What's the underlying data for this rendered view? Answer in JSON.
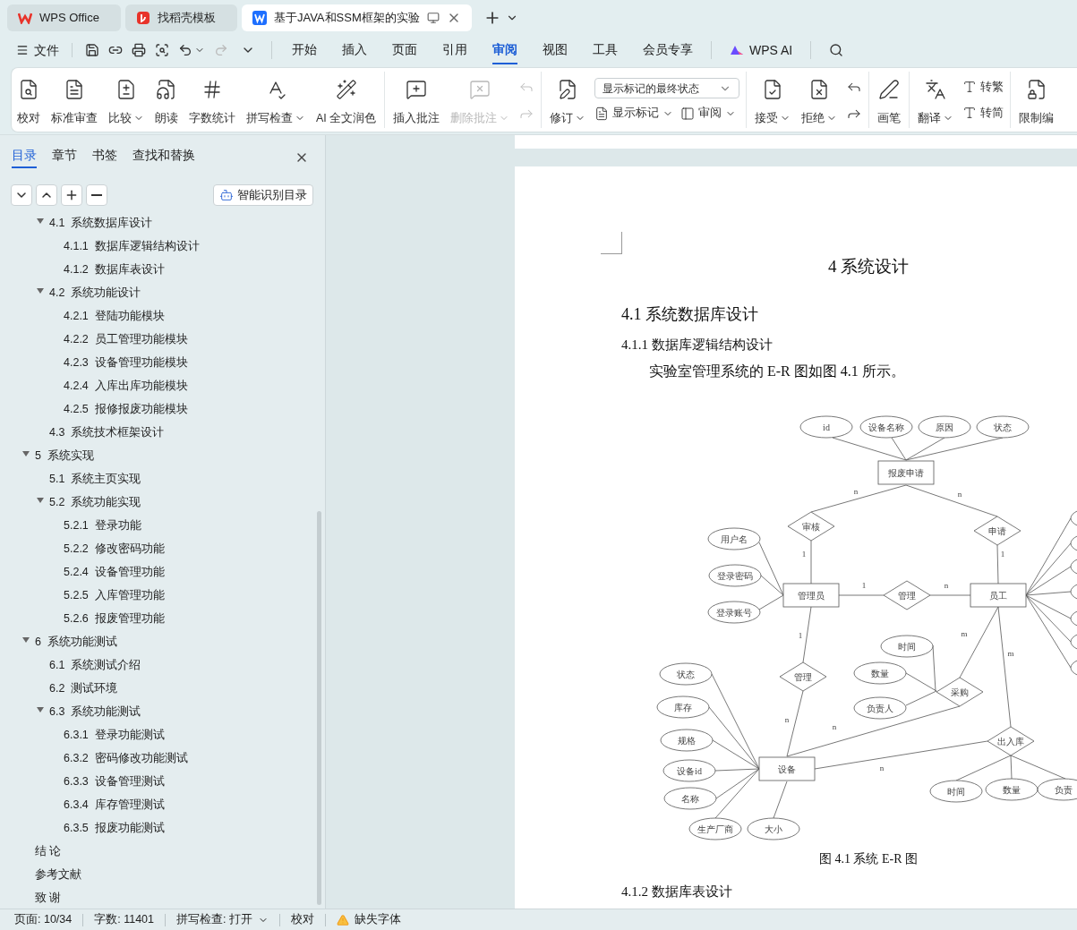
{
  "tabs": [
    {
      "label": "WPS Office",
      "selected": false
    },
    {
      "label": "找稻壳模板",
      "selected": false
    },
    {
      "label": "基于JAVA和SSM框架的实验",
      "selected": true
    }
  ],
  "quick_toolbar": {
    "file_label": "文件",
    "redo_disabled": true
  },
  "menu": [
    {
      "label": "开始",
      "selected": false
    },
    {
      "label": "插入",
      "selected": false
    },
    {
      "label": "页面",
      "selected": false
    },
    {
      "label": "引用",
      "selected": false
    },
    {
      "label": "审阅",
      "selected": true
    },
    {
      "label": "视图",
      "selected": false
    },
    {
      "label": "工具",
      "selected": false
    },
    {
      "label": "会员专享",
      "selected": false
    }
  ],
  "ai_label": "WPS AI",
  "ribbon": [
    {
      "items": [
        {
          "kind": "large",
          "label": "校对",
          "dropdown": false,
          "disabled": false
        },
        {
          "kind": "large",
          "label": "标准审查",
          "dropdown": false,
          "disabled": false
        },
        {
          "kind": "large",
          "label": "比较",
          "dropdown": true,
          "disabled": false
        },
        {
          "kind": "large",
          "label": "朗读",
          "dropdown": false,
          "disabled": false
        },
        {
          "kind": "large",
          "label": "字数统计",
          "dropdown": false,
          "disabled": false
        },
        {
          "kind": "large",
          "label": "拼写检查",
          "dropdown": true,
          "disabled": false
        },
        {
          "kind": "large",
          "label": "AI 全文润色",
          "dropdown": false,
          "disabled": false
        }
      ]
    },
    {
      "items": [
        {
          "kind": "large",
          "label": "插入批注",
          "dropdown": false,
          "disabled": false
        },
        {
          "kind": "large",
          "label": "删除批注",
          "dropdown": true,
          "disabled": true
        },
        {
          "kind": "pair",
          "disabled": true
        }
      ]
    },
    {
      "items": [
        {
          "kind": "large",
          "label": "修订",
          "dropdown": true,
          "disabled": false
        },
        {
          "kind": "markup",
          "select": "显示标记的最终状态",
          "buttons": [
            {
              "label": "显示标记",
              "dropdown": true
            },
            {
              "label": "审阅",
              "dropdown": true
            }
          ]
        }
      ]
    },
    {
      "items": [
        {
          "kind": "large",
          "label": "接受",
          "dropdown": true,
          "disabled": false
        },
        {
          "kind": "large",
          "label": "拒绝",
          "dropdown": true,
          "disabled": false
        },
        {
          "kind": "pair",
          "disabled": false
        }
      ]
    },
    {
      "items": [
        {
          "kind": "large",
          "label": "画笔",
          "dropdown": false,
          "disabled": false
        }
      ]
    },
    {
      "items": [
        {
          "kind": "large",
          "label": "翻译",
          "dropdown": true,
          "disabled": false
        },
        {
          "kind": "stack",
          "buttons": [
            {
              "label": "转繁"
            },
            {
              "label": "转简"
            }
          ]
        }
      ]
    },
    {
      "items": [
        {
          "kind": "large",
          "label": "限制编",
          "dropdown": false,
          "disabled": false
        }
      ]
    }
  ],
  "sidebar": {
    "tabs": [
      {
        "label": "目录",
        "selected": true
      },
      {
        "label": "章节",
        "selected": false
      },
      {
        "label": "书签",
        "selected": false
      },
      {
        "label": "查找和替换",
        "selected": false
      }
    ],
    "smart_toc_button": "智能识别目录",
    "toc_continued": [
      {
        "number": "4.1",
        "title": "系统数据库设计",
        "expanded": true,
        "children": [
          {
            "number": "4.1.1",
            "title": "数据库逻辑结构设计"
          },
          {
            "number": "4.1.2",
            "title": "数据库表设计"
          }
        ]
      },
      {
        "number": "4.2",
        "title": "系统功能设计",
        "expanded": true,
        "children": [
          {
            "number": "4.2.1",
            "title": "登陆功能模块"
          },
          {
            "number": "4.2.2",
            "title": "员工管理功能模块"
          },
          {
            "number": "4.2.3",
            "title": "设备管理功能模块"
          },
          {
            "number": "4.2.4",
            "title": "入库出库功能模块"
          },
          {
            "number": "4.2.5",
            "title": "报修报废功能模块"
          }
        ]
      },
      {
        "number": "4.3",
        "title": "系统技术框架设计"
      }
    ],
    "toc": [
      {
        "number": "5",
        "title": "系统实现",
        "expanded": true,
        "children": [
          {
            "number": "5.1",
            "title": "系统主页实现"
          },
          {
            "number": "5.2",
            "title": "系统功能实现",
            "expanded": true,
            "children": [
              {
                "number": "5.2.1",
                "title": "登录功能"
              },
              {
                "number": "5.2.2",
                "title": "修改密码功能"
              },
              {
                "number": "5.2.4",
                "title": "设备管理功能"
              },
              {
                "number": "5.2.5",
                "title": "入库管理功能"
              },
              {
                "number": "5.2.6",
                "title": "报废管理功能"
              }
            ]
          }
        ]
      },
      {
        "number": "6",
        "title": "系统功能测试",
        "expanded": true,
        "children": [
          {
            "number": "6.1",
            "title": "系统测试介绍"
          },
          {
            "number": "6.2",
            "title": "测试环境"
          },
          {
            "number": "6.3",
            "title": "系统功能测试",
            "expanded": true,
            "children": [
              {
                "number": "6.3.1",
                "title": "登录功能测试"
              },
              {
                "number": "6.3.2",
                "title": "密码修改功能测试"
              },
              {
                "number": "6.3.3",
                "title": "设备管理测试"
              },
              {
                "number": "6.3.4",
                "title": "库存管理测试"
              },
              {
                "number": "6.3.5",
                "title": "报废功能测试"
              }
            ]
          }
        ]
      },
      {
        "title": "结 论"
      },
      {
        "title": "参考文献"
      },
      {
        "title": "致 谢"
      }
    ]
  },
  "document": {
    "chapter_title": "4 系统设计",
    "section_title": "4.1 系统数据库设计",
    "subsection_title": "4.1.1 数据库逻辑结构设计",
    "paragraph": "实验室管理系统的 E-R 图如图 4.1 所示。",
    "figure": {
      "caption": "图 4.1 系统 E-R 图",
      "nodes": [
        {
          "kind": "attribute",
          "label": "id"
        },
        {
          "kind": "attribute",
          "label": "设备名称"
        },
        {
          "kind": "attribute",
          "label": "原因"
        },
        {
          "kind": "attribute",
          "label": "状态"
        },
        {
          "kind": "entity",
          "label": "报废申请"
        },
        {
          "kind": "relation",
          "label": "审核"
        },
        {
          "kind": "relation",
          "label": "申请"
        },
        {
          "kind": "attribute",
          "label": "用户名"
        },
        {
          "kind": "attribute",
          "label": "登录密码"
        },
        {
          "kind": "attribute",
          "label": "登录账号"
        },
        {
          "kind": "entity",
          "label": "管理员"
        },
        {
          "kind": "relation",
          "label": "管理"
        },
        {
          "kind": "entity",
          "label": "员工"
        },
        {
          "kind": "relation",
          "label": "管理"
        },
        {
          "kind": "attribute",
          "label": "时间"
        },
        {
          "kind": "attribute",
          "label": "数量"
        },
        {
          "kind": "attribute",
          "label": "负责人"
        },
        {
          "kind": "relation",
          "label": "采购"
        },
        {
          "kind": "attribute",
          "label": "状态"
        },
        {
          "kind": "attribute",
          "label": "库存"
        },
        {
          "kind": "attribute",
          "label": "规格"
        },
        {
          "kind": "attribute",
          "label": "设备id"
        },
        {
          "kind": "attribute",
          "label": "名称"
        },
        {
          "kind": "attribute",
          "label": "生产厂商"
        },
        {
          "kind": "attribute",
          "label": "大小"
        },
        {
          "kind": "entity",
          "label": "设备"
        },
        {
          "kind": "relation",
          "label": "出入库"
        },
        {
          "kind": "attribute",
          "label": "时间"
        },
        {
          "kind": "attribute",
          "label": "数量"
        },
        {
          "kind": "attribute",
          "label": "负责"
        }
      ],
      "cardinalities": [
        "n",
        "n",
        "1",
        "1",
        "1",
        "n",
        "1",
        "m",
        "m",
        "n",
        "n",
        "n"
      ]
    },
    "next_heading": "4.1.2 数据库表设计"
  },
  "status_bar": [
    {
      "label": "页面: 10/34",
      "dropdown": false,
      "warning": false
    },
    {
      "label": "字数: 11401",
      "dropdown": false,
      "warning": false
    },
    {
      "label": "拼写检查: 打开",
      "dropdown": true,
      "warning": false
    },
    {
      "label": "校对",
      "dropdown": false,
      "warning": false
    },
    {
      "label": "缺失字体",
      "dropdown": false,
      "warning": true
    }
  ]
}
